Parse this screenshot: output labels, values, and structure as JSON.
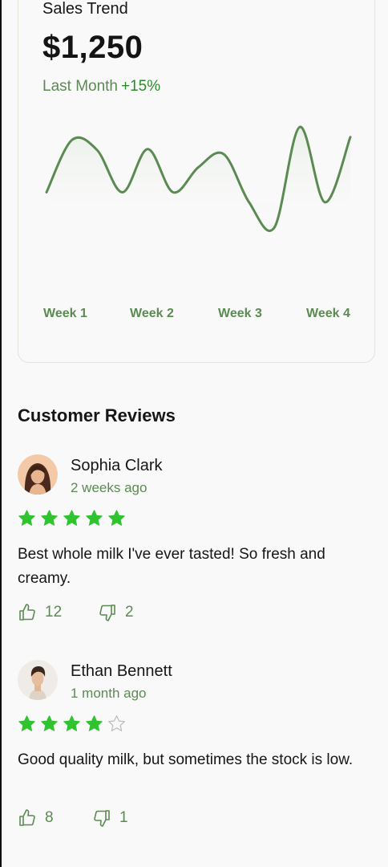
{
  "sales": {
    "title": "Sales Trend",
    "amount": "$1,250",
    "period": "Last Month",
    "change": "+15%"
  },
  "chart_data": {
    "type": "line",
    "x": [
      "Week 1",
      "Week 2",
      "Week 3",
      "Week 4"
    ],
    "series_trend": [
      0.3,
      0.82,
      0.72,
      0.3,
      0.73,
      0.3,
      0.55,
      0.68,
      0.2,
      -0.05,
      0.95,
      0.2,
      0.85
    ],
    "fill": true,
    "grid": false,
    "line_color": "#5b8a52"
  },
  "reviews_section": {
    "title": "Customer Reviews"
  },
  "reviews": [
    {
      "name": "Sophia Clark",
      "date": "2 weeks ago",
      "rating": 5,
      "text": "Best whole milk I've ever tasted! So fresh and creamy.",
      "likes": "12",
      "dislikes": "2"
    },
    {
      "name": "Ethan Bennett",
      "date": "1 month ago",
      "rating": 4,
      "text": "Good quality milk, but sometimes the stock is low.",
      "likes": "8",
      "dislikes": "1"
    }
  ],
  "colors": {
    "accent": "#5b8a52",
    "star": "#2fc42f",
    "star_empty": "#b8b8b8"
  },
  "icons": [
    "thumbs-up-icon",
    "thumbs-down-icon",
    "star-icon",
    "star-outline-icon"
  ]
}
